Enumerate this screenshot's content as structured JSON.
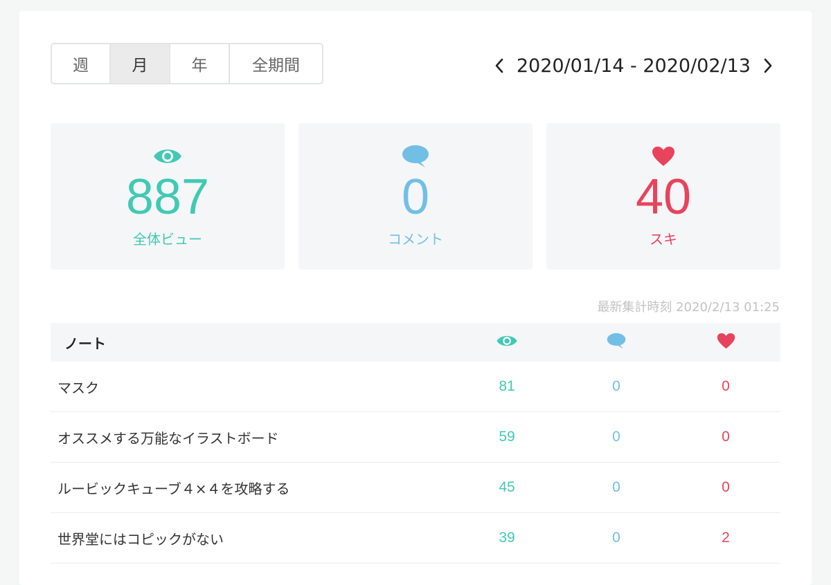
{
  "period_tabs": [
    {
      "label": "週",
      "active": false
    },
    {
      "label": "月",
      "active": true
    },
    {
      "label": "年",
      "active": false
    },
    {
      "label": "全期間",
      "active": false
    }
  ],
  "date_range": "2020/01/14 - 2020/02/13",
  "stats": {
    "views": {
      "value": "887",
      "label": "全体ビュー",
      "icon": "eye-icon",
      "color": "#41c9b4"
    },
    "comments": {
      "value": "0",
      "label": "コメント",
      "icon": "speech-bubble-icon",
      "color": "#72bfe6"
    },
    "likes": {
      "value": "40",
      "label": "スキ",
      "icon": "heart-icon",
      "color": "#e8435d"
    }
  },
  "updated_at": "最新集計時刻 2020/2/13 01:25",
  "table": {
    "header_title": "ノート",
    "rows": [
      {
        "title": "マスク",
        "views": "81",
        "comments": "0",
        "likes": "0"
      },
      {
        "title": "オススメする万能なイラストボード",
        "views": "59",
        "comments": "0",
        "likes": "0"
      },
      {
        "title": "ルービックキューブ４×４を攻略する",
        "views": "45",
        "comments": "0",
        "likes": "0"
      },
      {
        "title": "世界堂にはコピックがない",
        "views": "39",
        "comments": "0",
        "likes": "2"
      }
    ]
  }
}
